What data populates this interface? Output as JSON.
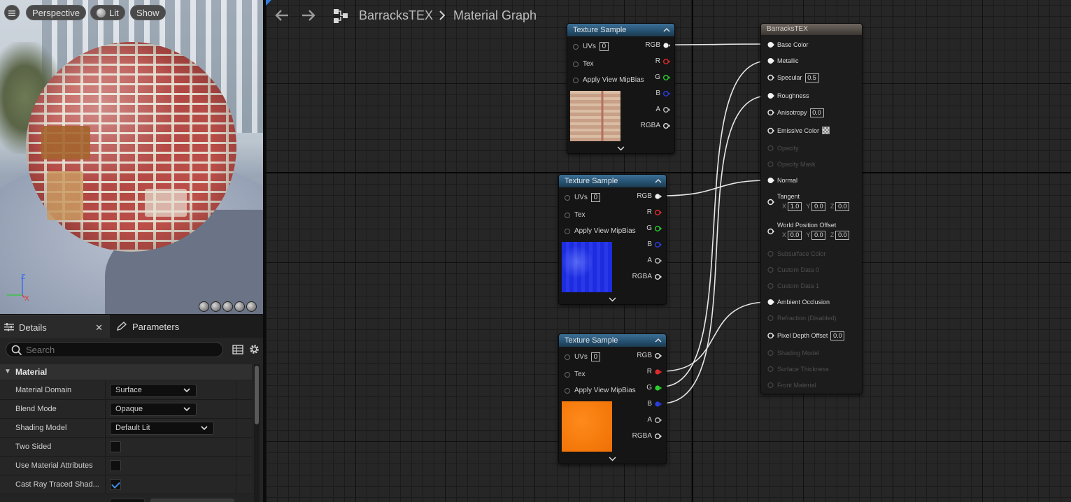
{
  "viewport": {
    "perspective_label": "Perspective",
    "lit_label": "Lit",
    "show_label": "Show",
    "axis_z": "Z",
    "axis_x": "X"
  },
  "details": {
    "tab_details": "Details",
    "tab_close": "✕",
    "tab_parameters": "Parameters",
    "search_placeholder": "Search",
    "category": "Material",
    "rows": [
      {
        "label": "Material Domain",
        "value": "Surface"
      },
      {
        "label": "Blend Mode",
        "value": "Opaque"
      },
      {
        "label": "Shading Model",
        "value": "Default Lit"
      },
      {
        "label": "Two Sided",
        "checked": false
      },
      {
        "label": "Use Material Attributes",
        "checked": false
      },
      {
        "label": "Cast Ray Traced Shad...",
        "checked": true
      }
    ]
  },
  "graph": {
    "asset_name": "BarracksTEX",
    "graph_name": "Material Graph",
    "texture_nodes": [
      {
        "title": "Texture Sample",
        "uvs": "0",
        "inputs": [
          "UVs",
          "Tex",
          "Apply View MipBias"
        ],
        "outputs": [
          "RGB",
          "R",
          "G",
          "B",
          "A",
          "RGBA"
        ]
      },
      {
        "title": "Texture Sample",
        "uvs": "0",
        "inputs": [
          "UVs",
          "Tex",
          "Apply View MipBias"
        ],
        "outputs": [
          "RGB",
          "R",
          "G",
          "B",
          "A",
          "RGBA"
        ]
      },
      {
        "title": "Texture Sample",
        "uvs": "0",
        "inputs": [
          "UVs",
          "Tex",
          "Apply View MipBias"
        ],
        "outputs": [
          "RGB",
          "R",
          "G",
          "B",
          "A",
          "RGBA"
        ]
      }
    ],
    "result_node": {
      "title": "BarracksTEX",
      "specular": "0.5",
      "anisotropy": "0.0",
      "tangent": {
        "x": "1.0",
        "y": "0.0",
        "z": "0.0"
      },
      "wpo": {
        "x": "0.0",
        "y": "0.0",
        "z": "0.0"
      },
      "pixel_depth_offset": "0.0",
      "axis_x": "X",
      "axis_y": "Y",
      "axis_z": "Z",
      "pins": {
        "base_color": "Base Color",
        "metallic": "Metallic",
        "specular": "Specular",
        "roughness": "Roughness",
        "anisotropy": "Anisotropy",
        "emissive": "Emissive Color",
        "opacity": "Opacity",
        "opacity_mask": "Opacity Mask",
        "normal": "Normal",
        "tangent": "Tangent",
        "wpo": "World Position Offset",
        "subsurface": "Subsurface Color",
        "custom0": "Custom Data 0",
        "custom1": "Custom Data 1",
        "ao": "Ambient Occlusion",
        "refraction": "Refraction (Disabled)",
        "pdo": "Pixel Depth Offset",
        "shading_model": "Shading Model",
        "thickness": "Surface Thickness",
        "front_material": "Front Material"
      }
    }
  },
  "colors": {
    "accent": "#2f7de1",
    "pin_red": "#e02a2a",
    "pin_green": "#2ad12a",
    "pin_blue": "#2a3ee0"
  }
}
